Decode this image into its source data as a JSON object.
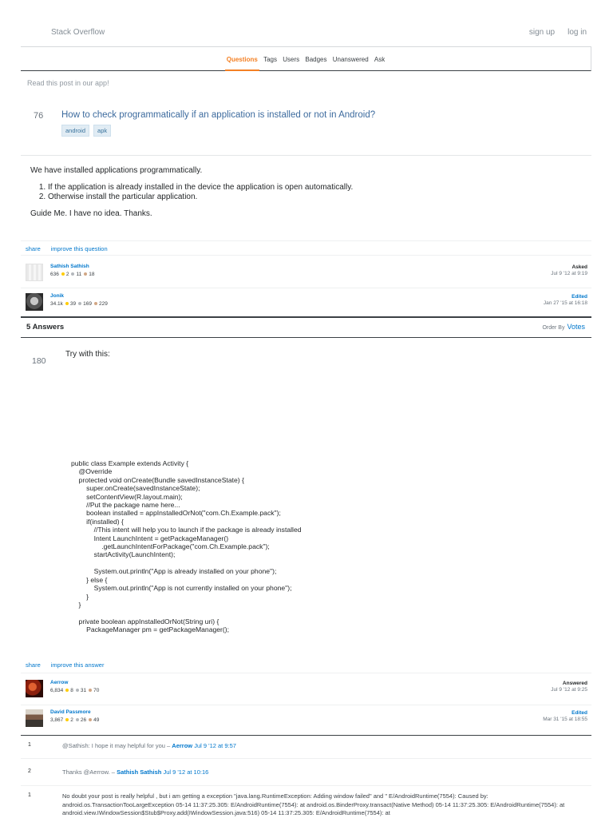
{
  "header": {
    "site_name": "Stack Overflow",
    "sign_up": "sign up",
    "log_in": "log in"
  },
  "nav": {
    "items": [
      "Questions",
      "Tags",
      "Users",
      "Badges",
      "Unanswered",
      "Ask"
    ],
    "active": "Questions"
  },
  "app_note": "Read this post in our app!",
  "question": {
    "score": "76",
    "title": "How to check programmatically if an application is installed or not in Android?",
    "tags": [
      "android",
      "apk"
    ],
    "intro": "We have installed applications programmatically.",
    "list": [
      "If the application is already installed in the device the application is open automatically.",
      "Otherwise install the particular application."
    ],
    "outro": "Guide Me. I have no idea. Thanks.",
    "share": "share",
    "improve": "improve this question",
    "asker": {
      "name": "Sathish Sathish",
      "rep": "636",
      "gold": "2",
      "silver": "11",
      "bronze": "18",
      "label": "Asked",
      "time": "Jul 9 '12 at 9:19"
    },
    "editor": {
      "name": "Jonik",
      "rep": "34.1k",
      "gold": "39",
      "silver": "169",
      "bronze": "229",
      "label": "Edited",
      "time": "Jan 27 '15 at 16:18"
    }
  },
  "answers": {
    "count_label": "5 Answers",
    "order_by": "Order By",
    "sort": "Votes"
  },
  "answer": {
    "score": "180",
    "text": "Try with this:",
    "code": "public class Example extends Activity {\n    @Override\n    protected void onCreate(Bundle savedInstanceState) {\n        super.onCreate(savedInstanceState);\n        setContentView(R.layout.main);\n        //Put the package name here...\n        boolean installed = appInstalledOrNot(\"com.Ch.Example.pack\");\n        if(installed) {\n            //This intent will help you to launch if the package is already installed\n            Intent LaunchIntent = getPackageManager()\n                .getLaunchIntentForPackage(\"com.Ch.Example.pack\");\n            startActivity(LaunchIntent);\n\n            System.out.println(\"App is already installed on your phone\");\n        } else {\n            System.out.println(\"App is not currently installed on your phone\");\n        }\n    }\n\n    private boolean appInstalledOrNot(String uri) {\n        PackageManager pm = getPackageManager();",
    "share": "share",
    "improve": "improve this answer",
    "answerer": {
      "name": "Aerrow",
      "rep": "6,834",
      "gold": "8",
      "silver": "31",
      "bronze": "70",
      "label": "Answered",
      "time": "Jul 9 '12 at 9:25"
    },
    "editor": {
      "name": "David Passmore",
      "rep": "3,867",
      "gold": "2",
      "silver": "26",
      "bronze": "49",
      "label": "Edited",
      "time": "Mar 31 '15 at 18:55"
    }
  },
  "comments": [
    {
      "score": "1",
      "text": "@Sathish: I hope it may helpful for you –",
      "user": "Aerrow",
      "date": "Jul 9 '12 at 9:57"
    },
    {
      "score": "2",
      "text": "Thanks @Aerrow. –",
      "user": "Sathish Sathish",
      "date": "Jul 9 '12 at 10:16"
    },
    {
      "score": "1",
      "text": "No doubt your post is really helpful , but i am getting a exception \"java.lang.RuntimeException: Adding window failed\" and \" E/AndroidRuntime(7554): Caused by: android.os.TransactionTooLargeException 05-14 11:37:25.305: E/AndroidRuntime(7554): at android.os.BinderProxy.transact(Native Method) 05-14 11:37:25.305: E/AndroidRuntime(7554): at android.view.IWindowSession$Stub$Proxy.add(IWindowSession.java:516) 05-14 11:37:25.305: E/AndroidRuntime(7554): at",
      "user": "",
      "date": ""
    }
  ]
}
